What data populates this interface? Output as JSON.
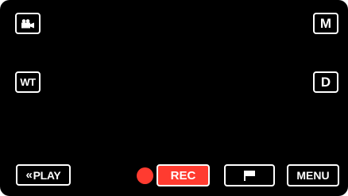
{
  "top_left": {
    "icon": "movie-camera-icon"
  },
  "zoom": {
    "label": "WT"
  },
  "mode": {
    "label": "M"
  },
  "display": {
    "label": "D"
  },
  "playback": {
    "label": "PLAY",
    "icon": "double-chevron-left-icon"
  },
  "record": {
    "label": "REC",
    "indicator_color": "#ff3b30",
    "button_color": "#ff3b30"
  },
  "flag": {
    "icon": "flag-icon"
  },
  "menu": {
    "label": "MENU"
  }
}
